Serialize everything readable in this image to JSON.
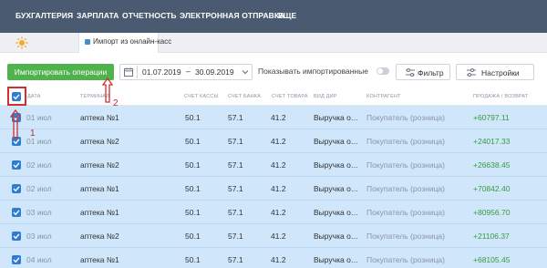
{
  "nav": {
    "items": [
      "БУХГАЛТЕРИЯ",
      "ЗАРПЛАТА",
      "ОТЧЕТНОСТЬ",
      "ЭЛЕКТРОННАЯ ОТПРАВКА",
      "ЕЩЕ"
    ]
  },
  "tabs": {
    "active_label": "Импорт из онлайн-касс"
  },
  "toolbar": {
    "import_label": "Импортировать операции",
    "date_from": "01.07.2019",
    "date_dash": "–",
    "date_to": "30.09.2019",
    "show_imported_label": "Показывать импортированные",
    "filter_label": "Фильтр",
    "settings_label": "Настройки"
  },
  "table": {
    "headers": [
      "ДАТА",
      "ТЕРМИНАЛ",
      "СЧЕТ КАССЫ",
      "СЧЕТ БАНКА",
      "СЧЕТ ТОВАРА",
      "ВИД ДИР",
      "КОНТРАГЕНТ",
      "ПРОДАЖА / ВОЗВРАТ"
    ],
    "rows": [
      {
        "date": "01 июл",
        "terminal": "аптека №1",
        "cash": "50.1",
        "bank": "57.1",
        "goods": "41.2",
        "kind": "Выручка о…",
        "contractor": "Покупатель (розница)",
        "amount": "+60797.11"
      },
      {
        "date": "01 июл",
        "terminal": "аптека №2",
        "cash": "50.1",
        "bank": "57.1",
        "goods": "41.2",
        "kind": "Выручка о…",
        "contractor": "Покупатель (розница)",
        "amount": "+24017.33"
      },
      {
        "date": "02 июл",
        "terminal": "аптека №2",
        "cash": "50.1",
        "bank": "57.1",
        "goods": "41.2",
        "kind": "Выручка о…",
        "contractor": "Покупатель (розница)",
        "amount": "+26638.45"
      },
      {
        "date": "02 июл",
        "terminal": "аптека №1",
        "cash": "50.1",
        "bank": "57.1",
        "goods": "41.2",
        "kind": "Выручка о…",
        "contractor": "Покупатель (розница)",
        "amount": "+70842.40"
      },
      {
        "date": "03 июл",
        "terminal": "аптека №1",
        "cash": "50.1",
        "bank": "57.1",
        "goods": "41.2",
        "kind": "Выручка о…",
        "contractor": "Покупатель (розница)",
        "amount": "+80956.70"
      },
      {
        "date": "03 июл",
        "terminal": "аптека №2",
        "cash": "50.1",
        "bank": "57.1",
        "goods": "41.2",
        "kind": "Выручка о…",
        "contractor": "Покупатель (розница)",
        "amount": "+21106.37"
      },
      {
        "date": "04 июл",
        "terminal": "аптека №1",
        "cash": "50.1",
        "bank": "57.1",
        "goods": "41.2",
        "kind": "Выручка о…",
        "contractor": "Покупатель (розница)",
        "amount": "+68105.45"
      }
    ]
  },
  "annotations": {
    "marker_1": "1",
    "marker_2": "2"
  },
  "colors": {
    "nav_bg": "#4a5a70",
    "accent_green": "#4fb24c",
    "checkbox_blue": "#2f7dd1",
    "selected_row_bg": "#cfe6fb",
    "amount_green": "#3a9a3d",
    "annotation_red": "#d32f2f"
  },
  "icons": [
    "sun-icon",
    "calendar-icon",
    "chevron-down-icon",
    "sliders-icon",
    "check-icon"
  ]
}
